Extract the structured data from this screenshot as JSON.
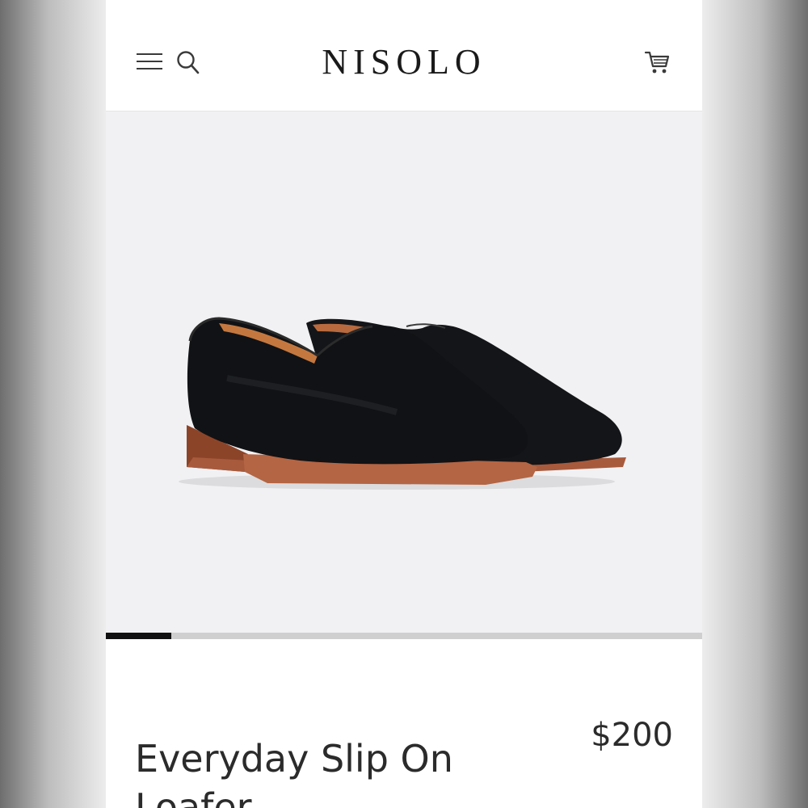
{
  "header": {
    "brand": "NISOLO",
    "icons": [
      "hamburger-menu-icon",
      "search-icon",
      "cart-icon"
    ]
  },
  "gallery": {
    "image_subject": "black leather slip-on loafers",
    "progress_fraction": 0.11
  },
  "product": {
    "title": "Everyday Slip On Loafer",
    "price": "$200"
  },
  "colors": {
    "text": "#2b2b2b",
    "hero_background": "#f1f1f3",
    "progress_fill": "#111111",
    "progress_track": "#cfcfcf"
  }
}
